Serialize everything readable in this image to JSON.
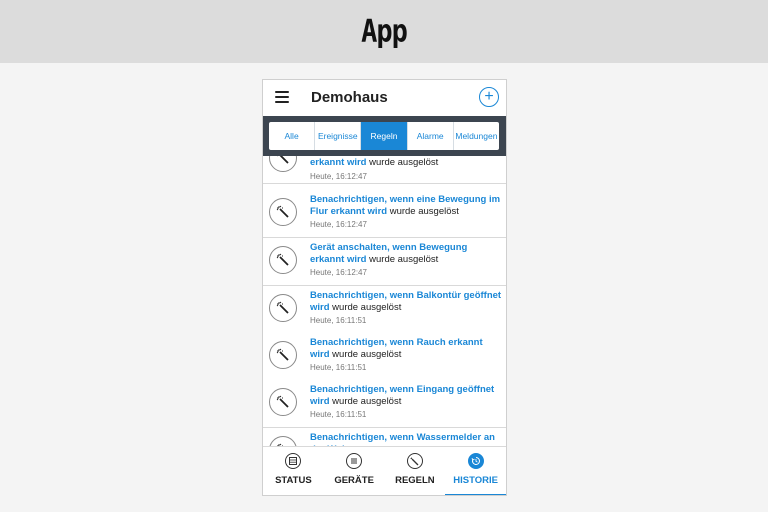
{
  "page": {
    "title": "App"
  },
  "header": {
    "title": "Demohaus",
    "add_icon": "plus-circle-icon",
    "menu_icon": "hamburger-menu-icon"
  },
  "filters": [
    {
      "label": "Alle",
      "active": false
    },
    {
      "label": "Ereignisse",
      "active": false
    },
    {
      "label": "Regeln",
      "active": true
    },
    {
      "label": "Alarme",
      "active": false
    },
    {
      "label": "Meldungen",
      "active": false
    }
  ],
  "history": [
    {
      "link": "erkannt wird",
      "rest": " wurde ausgelöst",
      "time": "Heute, 16:12:47"
    },
    {
      "link": "Benachrichtigen, wenn eine Bewegung im Flur erkannt wird",
      "rest": " wurde ausgelöst",
      "time": "Heute, 16:12:47"
    },
    {
      "link": "Gerät anschalten, wenn Bewegung erkannt wird",
      "rest": " wurde ausgelöst",
      "time": "Heute, 16:12:47"
    },
    {
      "link": "Benachrichtigen, wenn Balkontür geöffnet wird",
      "rest": " wurde ausgelöst",
      "time": "Heute, 16:11:51"
    },
    {
      "link": "Benachrichtigen, wenn Rauch erkannt wird",
      "rest": " wurde ausgelöst",
      "time": "Heute, 16:11:51"
    },
    {
      "link": "Benachrichtigen, wenn Eingang geöffnet wird",
      "rest": " wurde ausgelöst",
      "time": "Heute, 16:11:51"
    },
    {
      "link": "Benachrichtigen, wenn Wassermelder an der Wohnung",
      "rest": "",
      "time": ""
    }
  ],
  "nav": [
    {
      "label": "STATUS",
      "icon": "status-grid-icon",
      "active": false
    },
    {
      "label": "GERÄTE",
      "icon": "devices-list-icon",
      "active": false
    },
    {
      "label": "REGELN",
      "icon": "magic-wand-icon",
      "active": false
    },
    {
      "label": "HISTORIE",
      "icon": "history-icon",
      "active": true
    }
  ],
  "colors": {
    "accent": "#1a87d6",
    "filter_bar": "#3c4550",
    "top_band": "#dcdcdc"
  }
}
